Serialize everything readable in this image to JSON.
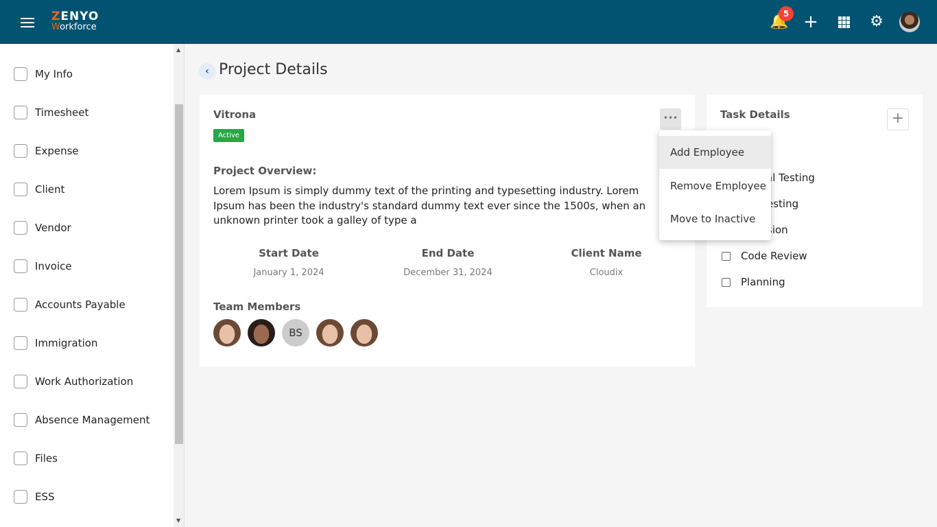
{
  "header": {
    "brand_line1": "ZENYO",
    "brand_line2": "Workforce",
    "notification_count": "5",
    "icons": [
      "menu-icon",
      "bell-icon",
      "plus-icon",
      "apps-grid-icon",
      "gear-icon",
      "user-avatar"
    ]
  },
  "sidebar": {
    "items": [
      {
        "label": "My Info",
        "icon": "user-icon"
      },
      {
        "label": "Timesheet",
        "icon": "clock-icon"
      },
      {
        "label": "Expense",
        "icon": "money-hand-icon"
      },
      {
        "label": "Client",
        "icon": "person-icon"
      },
      {
        "label": "Vendor",
        "icon": "vendor-icon"
      },
      {
        "label": "Invoice",
        "icon": "invoice-icon"
      },
      {
        "label": "Accounts Payable",
        "icon": "payable-icon"
      },
      {
        "label": "Immigration",
        "icon": "globe-icon"
      },
      {
        "label": "Work Authorization",
        "icon": "briefcase-icon"
      },
      {
        "label": "Absence Management",
        "icon": "exit-door-icon"
      },
      {
        "label": "Files",
        "icon": "file-icon"
      },
      {
        "label": "ESS",
        "icon": "ess-icon"
      }
    ]
  },
  "page": {
    "title": "Project Details"
  },
  "project": {
    "name": "Vitrona",
    "status": "Active",
    "overview_label": "Project Overview:",
    "overview": "Lorem Ipsum is simply dummy text of the printing and typesetting industry. Lorem Ipsum has been the industry's standard dummy text ever since the 1500s, when an unknown printer took a galley of type a",
    "fields": [
      {
        "label": "Start Date",
        "value": "January 1, 2024"
      },
      {
        "label": "End Date",
        "value": "December 31, 2024"
      },
      {
        "label": "Client Name",
        "value": "Cloudix"
      }
    ],
    "team_label": "Team Members",
    "members": [
      {
        "type": "photo"
      },
      {
        "type": "photo"
      },
      {
        "initials": "BS"
      },
      {
        "type": "photo"
      },
      {
        "type": "photo"
      }
    ],
    "status_color": "#28a745"
  },
  "menu": {
    "items": [
      "Add Employee",
      "Remove Employee",
      "Move to Inactive"
    ]
  },
  "tasks": {
    "title": "Task Details",
    "items_partial": [
      "al Testing",
      "esting",
      "sion"
    ],
    "items": [
      "Code Review",
      "Planning"
    ]
  }
}
